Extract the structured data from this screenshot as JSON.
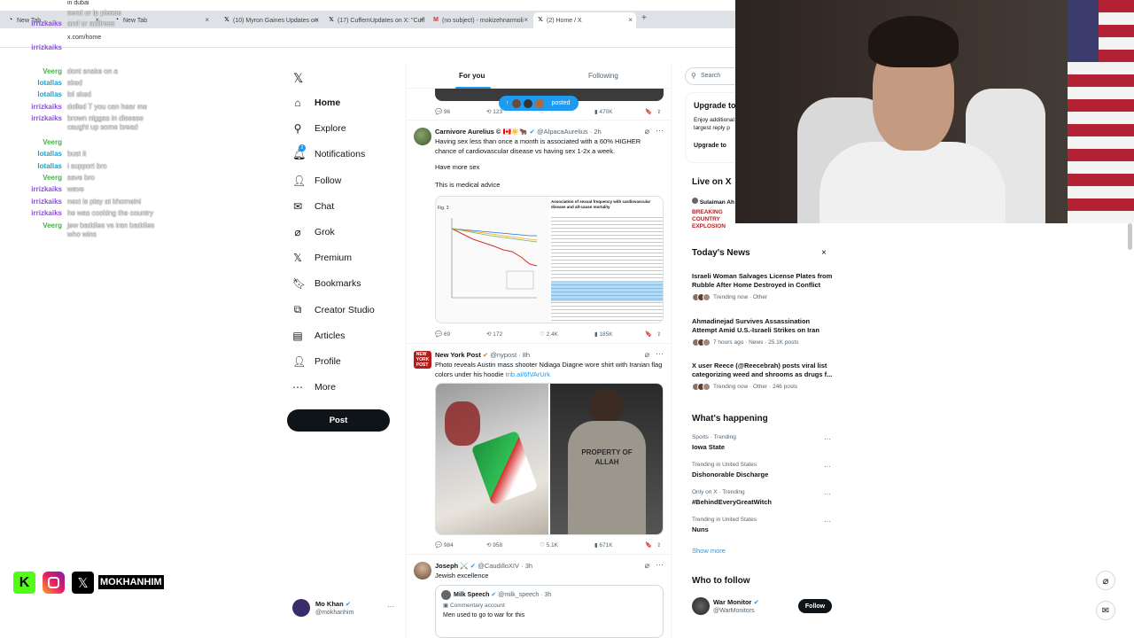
{
  "browser": {
    "tabs": [
      {
        "label": "New Tab"
      },
      {
        "label": "New Tab"
      },
      {
        "label": "(10) Myron Gaines Updates on"
      },
      {
        "label": "(17) CuffemUpdates on X: \"Cuff"
      },
      {
        "label": "(no subject) - mokizehnarmoli"
      },
      {
        "label": "(2) Home / X"
      }
    ],
    "url": "x.com/home",
    "add_tab": "+"
  },
  "chat": {
    "top_line": "in dubai",
    "header_line": "send ur ip please",
    "lines": [
      {
        "user": "irrizkaiks",
        "text": "and ur address",
        "color": "#8a4fd8"
      },
      {
        "user": "irrizkaiks",
        "text": "",
        "color": "#8a4fd8"
      },
      {
        "user": "Veerg",
        "text": "dont snake on a",
        "color": "#4cae4c"
      },
      {
        "user": "lotallas",
        "text": "sked",
        "color": "#22a0c8"
      },
      {
        "user": "lotallas",
        "text": "lol sked",
        "color": "#22a0c8"
      },
      {
        "user": "irrizkaiks",
        "text": "dolled T you can hear me",
        "color": "#8a4fd8"
      },
      {
        "user": "irrizkaiks",
        "text": "brown niggas in disease caught up some bread",
        "color": "#8a4fd8"
      },
      {
        "user": "Veerg",
        "text": "",
        "color": "#4cae4c"
      },
      {
        "user": "lotallas",
        "text": "bust it",
        "color": "#22a0c8"
      },
      {
        "user": "lotallas",
        "text": "i support bro",
        "color": "#22a0c8"
      },
      {
        "user": "Veerg",
        "text": "save bro",
        "color": "#4cae4c"
      },
      {
        "user": "irrizkaiks",
        "text": "wave",
        "color": "#8a4fd8"
      },
      {
        "user": "irrizkaiks",
        "text": "next is play at khomeini",
        "color": "#8a4fd8"
      },
      {
        "user": "irrizkaiks",
        "text": "he was cooking the country",
        "color": "#8a4fd8"
      },
      {
        "user": "Veerg",
        "text": "jew baddies vs iran baddies who wins",
        "color": "#4cae4c"
      }
    ]
  },
  "socials": {
    "handle": "MOKHANHIM"
  },
  "nav": {
    "items": [
      {
        "label": "Home",
        "icon": "home-icon"
      },
      {
        "label": "Explore",
        "icon": "search-icon"
      },
      {
        "label": "Notifications",
        "icon": "bell-icon",
        "badge": "2"
      },
      {
        "label": "Follow",
        "icon": "person-add-icon"
      },
      {
        "label": "Chat",
        "icon": "mail-icon"
      },
      {
        "label": "Grok",
        "icon": "grok-icon"
      },
      {
        "label": "Premium",
        "icon": "x-premium-icon"
      },
      {
        "label": "Bookmarks",
        "icon": "bookmark-icon"
      },
      {
        "label": "Creator Studio",
        "icon": "studio-icon"
      },
      {
        "label": "Articles",
        "icon": "articles-icon"
      },
      {
        "label": "Profile",
        "icon": "profile-icon"
      },
      {
        "label": "More",
        "icon": "more-icon"
      }
    ],
    "post_label": "Post",
    "account": {
      "name": "Mo Khan",
      "handle": "@mokhanhim"
    }
  },
  "timeline": {
    "tabs": [
      "For you",
      "Following"
    ],
    "posted_pill": "posted",
    "top_actions": {
      "replies": "96",
      "reposts": "123",
      "likes": "",
      "views": "470K"
    },
    "tweets": [
      {
        "name": "Carnivore Aurelius ©",
        "handle": "@AlpacaAurelius",
        "time": "2h",
        "text1": "Having sex less than once a month is associated with a 60% HIGHER chance of cardiovascular disease vs having sex 1-2x a week.",
        "text2": "Have more sex",
        "text3": "This is medical advice",
        "media_fig": "Fig. 3",
        "media_title": "Association of sexual frequency with cardiovascular disease and all-cause mortality",
        "replies": "69",
        "reposts": "172",
        "likes": "2.4K",
        "views": "185K"
      },
      {
        "name": "New York Post",
        "handle": "@nypost",
        "time": "8h",
        "text1": "Photo reveals Austin mass shooter Ndiaga Diagne wore shirt with Iranian flag colors under his hoodie",
        "link": "trib.al/6fVArUrk",
        "hoodie_text": "PROPERTY OF ALLAH",
        "replies": "984",
        "reposts": "958",
        "likes": "5.1K",
        "views": "671K"
      },
      {
        "name": "Joseph",
        "handle": "@CaudilloXIV",
        "time": "3h",
        "text1": "Jewish excellence",
        "quote_name": "Milk Speech",
        "quote_handle": "@milk_speech",
        "quote_time": "3h",
        "quote_label": "Commentary account",
        "quote_text": "Men used to go to war for this"
      }
    ]
  },
  "right": {
    "search_placeholder": "Search",
    "premium_title": "Upgrade to",
    "premium_text": "Enjoy additional largest reply p",
    "premium_btn": "Upgrade to",
    "live_title": "Live on X",
    "live_host": "Sulaiman Ah",
    "live_text": "BREAKING COUNTRY EXPLOSION",
    "news_title": "Today's News",
    "news": [
      {
        "title": "Israeli Woman Salvages License Plates from Rubble After Home Destroyed in Conflict",
        "meta": "Trending now · Other"
      },
      {
        "title": "Ahmadinejad Survives Assassination Attempt Amid U.S.-Israeli Strikes on Iran",
        "meta": "7 hours ago · News · 25.1K posts"
      },
      {
        "title": "X user Reece (@Reecebrah) posts viral list categorizing weed and shrooms as drugs f...",
        "meta": "Trending now · Other · 246 posts"
      }
    ],
    "happening_title": "What's happening",
    "trends": [
      {
        "meta": "Sports · Trending",
        "title": "Iowa State"
      },
      {
        "meta": "Trending in United States",
        "title": "Dishonorable Discharge"
      },
      {
        "meta": "Only on X · Trending",
        "title": "#BehindEveryGreatWitch"
      },
      {
        "meta": "Trending in United States",
        "title": "Nuns"
      }
    ],
    "show_more": "Show more",
    "who_title": "Who to follow",
    "follow_name": "War Monitor",
    "follow_handle": "@WarMonitors",
    "follow_btn": "Follow"
  },
  "colors": {
    "accent": "#1d9bf0",
    "text": "#0f1419",
    "muted": "#536471",
    "kick": "#53fc18"
  }
}
